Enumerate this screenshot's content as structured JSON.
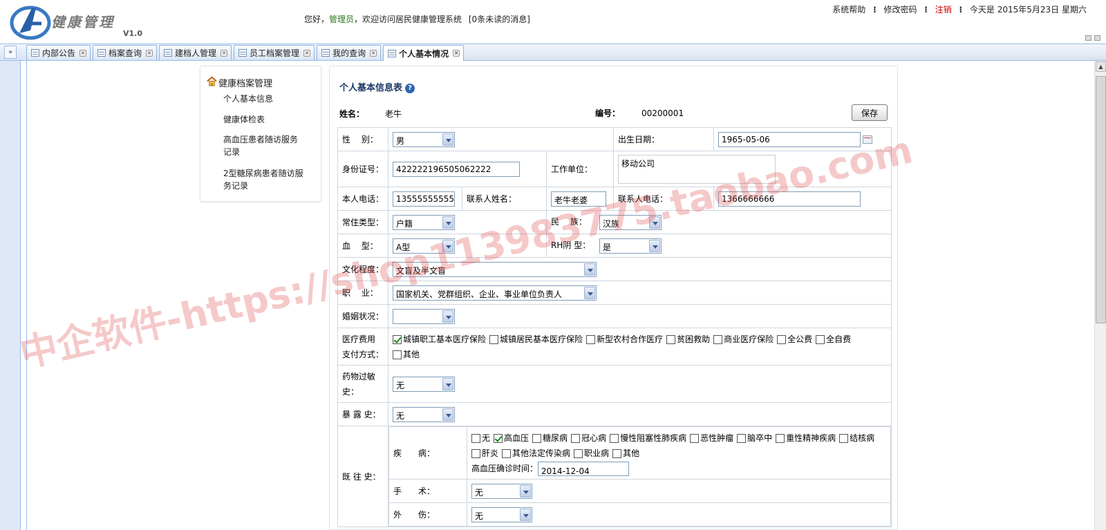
{
  "header": {
    "logo_text": "健康管理",
    "version": "V1.0",
    "welcome_prefix": "您好，",
    "user": "管理员",
    "welcome_suffix": "，欢迎访问居民健康管理系统",
    "messages": "[0条未读的消息]",
    "nav": {
      "help": "系统帮助",
      "change_password": "修改密码",
      "logout": "注销",
      "date": "今天是 2015年5月23日 星期六"
    }
  },
  "tabs": [
    {
      "label": "内部公告"
    },
    {
      "label": "档案查询"
    },
    {
      "label": "建档人管理"
    },
    {
      "label": "员工档案管理"
    },
    {
      "label": "我的查询"
    },
    {
      "label": "个人基本情况"
    }
  ],
  "collapse_label": "»",
  "sidemenu": {
    "title": "健康档案管理",
    "items": [
      {
        "label": "个人基本信息"
      },
      {
        "label": "健康体检表"
      },
      {
        "label": "高血压患者随访服务记录"
      },
      {
        "label": "2型糖尿病患者随访服务记录"
      }
    ]
  },
  "form": {
    "title": "个人基本信息表",
    "name_label": "姓名：",
    "name_value": "老牛",
    "id_label": "编号：",
    "id_value": "00200001",
    "save_label": "保存",
    "gender_label": "性　 别：",
    "gender_value": "男",
    "birth_label": "出生日期：",
    "birth_value": "1965-05-06",
    "idcard_label": "身份证号：",
    "idcard_value": "422222196505062222",
    "work_label": "工作单位：",
    "work_value": "移动公司",
    "phone_label": "本人电话：",
    "phone_value": "13555555555",
    "contact_name_label": "联系人姓名：",
    "contact_name_value": "老牛老婆",
    "contact_phone_label": "联系人电话：",
    "contact_phone_value": "1366666666",
    "residence_label": "常住类型：",
    "residence_value": "户籍",
    "ethnic_label": "民　 族：",
    "ethnic_value": "汉族",
    "blood_label": "血　 型：",
    "blood_value": "A型",
    "rh_label": "RH阴 型：",
    "rh_value": "是",
    "education_label": "文化程度：",
    "education_value": "文盲及半文盲",
    "occupation_label": "职　 业：",
    "occupation_value": "国家机关、党群组织、企业、事业单位负责人",
    "marriage_label": "婚姻状况：",
    "marriage_value": "",
    "payment_label_1": "医疗费用",
    "payment_label_2": "支付方式：",
    "payment_options": [
      {
        "label": "城镇职工基本医疗保险",
        "checked": true
      },
      {
        "label": "城镇居民基本医疗保险",
        "checked": false
      },
      {
        "label": "新型农村合作医疗",
        "checked": false
      },
      {
        "label": "贫困救助",
        "checked": false
      },
      {
        "label": "商业医疗保险",
        "checked": false
      },
      {
        "label": "全公费",
        "checked": false
      },
      {
        "label": "全自费",
        "checked": false
      },
      {
        "label": "其他",
        "checked": false
      }
    ],
    "allergy_label_1": "药物过敏",
    "allergy_label_2": "史：",
    "allergy_value": "无",
    "exposure_label": "暴 露 史：",
    "exposure_value": "无",
    "history_label": "既 往 史：",
    "disease_label": "疾　　病：",
    "disease_options": [
      {
        "label": "无",
        "checked": false
      },
      {
        "label": "高血压",
        "checked": true
      },
      {
        "label": "糖尿病",
        "checked": false
      },
      {
        "label": "冠心病",
        "checked": false
      },
      {
        "label": "慢性阻塞性肺疾病",
        "checked": false
      },
      {
        "label": "恶性肿瘤",
        "checked": false
      },
      {
        "label": "脑卒中",
        "checked": false
      },
      {
        "label": "重性精神疾病",
        "checked": false
      },
      {
        "label": "结核病",
        "checked": false
      },
      {
        "label": "肝炎",
        "checked": false
      },
      {
        "label": "其他法定传染病",
        "checked": false
      },
      {
        "label": "职业病",
        "checked": false
      },
      {
        "label": "其他",
        "checked": false
      }
    ],
    "hypertension_date_label": "高血压确诊时间：",
    "hypertension_date_value": "2014-12-04",
    "surgery_label": "手　　术：",
    "surgery_value": "无",
    "trauma_label": "外　　伤：",
    "trauma_value": "无"
  },
  "watermark": "中企软件-https://shop113983775.taobao.com",
  "colors": {
    "accent": "#99bbe8",
    "title": "#1a3766",
    "logout": "#cc0000",
    "user": "#2a7a1a"
  }
}
